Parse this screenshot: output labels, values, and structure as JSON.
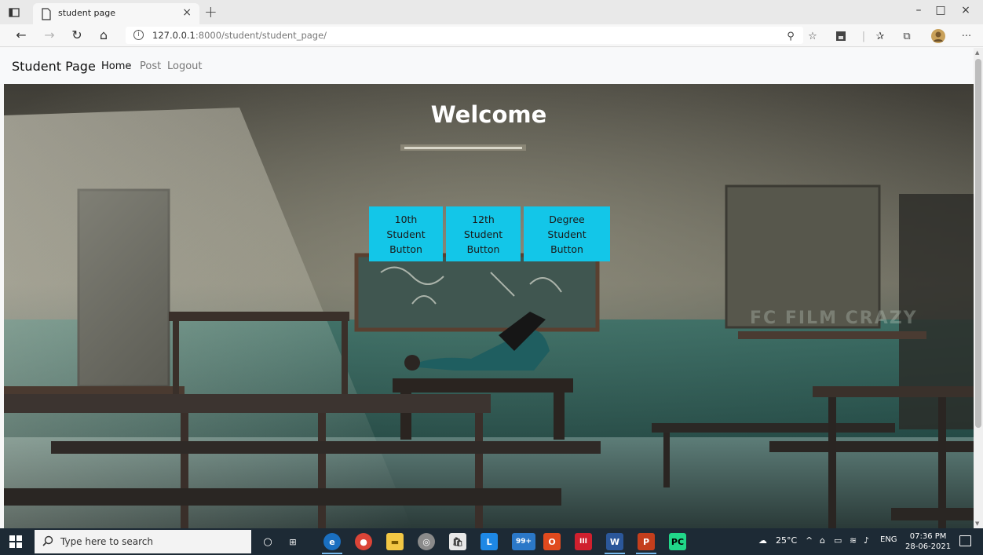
{
  "browser": {
    "tab_title": "student page",
    "tab_close": "×",
    "new_tab": "+",
    "url_host": "127.0.0.1",
    "url_path": ":8000/student/student_page/",
    "window_controls": [
      "–",
      "□",
      "×"
    ]
  },
  "navbar": {
    "brand": "Student Page",
    "links": [
      "Home",
      "Post",
      "Logout"
    ]
  },
  "hero": {
    "heading": "Welcome",
    "buttons": [
      {
        "line1": "10th Student",
        "line2": "Button"
      },
      {
        "line1": "12th Student",
        "line2": "Button"
      },
      {
        "line1": "Degree Student",
        "line2": "Button"
      }
    ],
    "watermark": "FC FILM CRAZY"
  },
  "taskbar": {
    "search_placeholder": "Type here to search",
    "weather": "25°C",
    "language": "ENG",
    "time": "07:36 PM",
    "date": "28-06-2021",
    "mail_badge": "99+"
  },
  "colors": {
    "button_bg": "#13c6e8",
    "taskbar_bg": "#1d2a35"
  }
}
